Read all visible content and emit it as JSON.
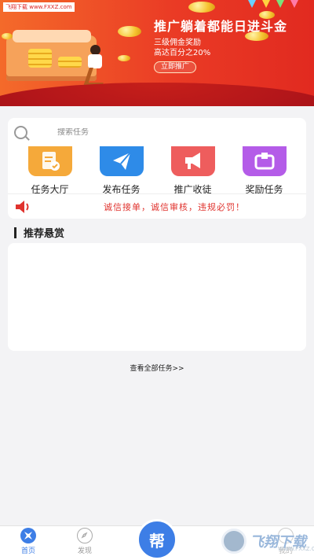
{
  "watermark": "飞翔下载 www.FXXZ.com",
  "banner": {
    "title": "推广躺着都能日进斗金",
    "sub1": "三级佣金奖励",
    "sub2": "高达百分之20%",
    "button": "立即推广"
  },
  "search": {
    "placeholder": "搜索任务"
  },
  "menu": [
    {
      "label": "任务大厅",
      "icon": "task-list-icon",
      "color": "#f5a93a"
    },
    {
      "label": "发布任务",
      "icon": "send-plane-icon",
      "color": "#2e8be8"
    },
    {
      "label": "推广收徒",
      "icon": "megaphone-icon",
      "color": "#ee5d5d"
    },
    {
      "label": "奖励任务",
      "icon": "gift-box-icon",
      "color": "#b45ce8"
    }
  ],
  "notice": {
    "text": "诚信接单，诚信审核，违规必罚！",
    "color": "#e0332e"
  },
  "section": {
    "title": "推荐悬赏"
  },
  "view_all": "查看全部任务>>",
  "bottom_nav": {
    "home": "首页",
    "discover": "发现",
    "center": "帮",
    "mine": "我的"
  },
  "logo": {
    "text": "飞翔下载",
    "sub": "WWW.FXXZ.COM"
  },
  "colors": {
    "accent": "#3d7ee6",
    "banner_red": "#e12a20"
  }
}
